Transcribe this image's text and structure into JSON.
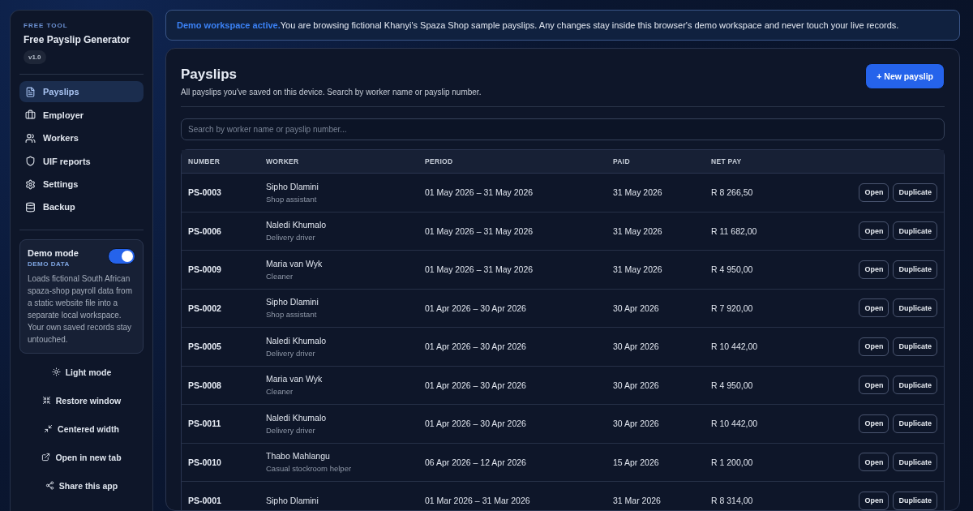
{
  "sidebar": {
    "eyebrow": "FREE TOOL",
    "title": "Free Payslip Generator",
    "version": "v1.0",
    "nav": [
      {
        "label": "Payslips",
        "selected": true
      },
      {
        "label": "Employer",
        "selected": false
      },
      {
        "label": "Workers",
        "selected": false
      },
      {
        "label": "UIF reports",
        "selected": false
      },
      {
        "label": "Settings",
        "selected": false
      },
      {
        "label": "Backup",
        "selected": false
      }
    ],
    "demo": {
      "title": "Demo mode",
      "on": true,
      "tag": "DEMO DATA",
      "text": "Loads fictional South African spaza-shop payroll data from a static website file into a separate local workspace. Your own saved records stay untouched."
    },
    "actions": [
      {
        "label": "Light mode"
      },
      {
        "label": "Restore window"
      },
      {
        "label": "Centered width"
      },
      {
        "label": "Open in new tab"
      },
      {
        "label": "Share this app"
      }
    ]
  },
  "banner": {
    "lead": "Demo workspace active.",
    "text": "You are browsing fictional Khanyi's Spaza Shop sample payslips. Any changes stay inside this browser's demo workspace and never touch your live records."
  },
  "page": {
    "title": "Payslips",
    "subtitle": "All payslips you've saved on this device. Search by worker name or payslip number.",
    "new_button": "+ New payslip",
    "search": {
      "placeholder": "Search by worker name or payslip number..."
    }
  },
  "table": {
    "columns": [
      "NUMBER",
      "WORKER",
      "PERIOD",
      "PAID",
      "NET PAY"
    ],
    "rows": [
      {
        "number": "PS-0003",
        "worker": "Sipho Dlamini",
        "role": "Shop assistant",
        "period": "01 May 2026 – 31 May 2026",
        "paid": "31 May 2026",
        "net": "R 8 266,50",
        "actions": [
          "Open",
          "Duplicate"
        ]
      },
      {
        "number": "PS-0006",
        "worker": "Naledi Khumalo",
        "role": "Delivery driver",
        "period": "01 May 2026 – 31 May 2026",
        "paid": "31 May 2026",
        "net": "R 11 682,00",
        "actions": [
          "Open",
          "Duplicate"
        ]
      },
      {
        "number": "PS-0009",
        "worker": "Maria van Wyk",
        "role": "Cleaner",
        "period": "01 May 2026 – 31 May 2026",
        "paid": "31 May 2026",
        "net": "R 4 950,00",
        "actions": [
          "Open",
          "Duplicate"
        ]
      },
      {
        "number": "PS-0002",
        "worker": "Sipho Dlamini",
        "role": "Shop assistant",
        "period": "01 Apr 2026 – 30 Apr 2026",
        "paid": "30 Apr 2026",
        "net": "R 7 920,00",
        "actions": [
          "Open",
          "Duplicate"
        ]
      },
      {
        "number": "PS-0005",
        "worker": "Naledi Khumalo",
        "role": "Delivery driver",
        "period": "01 Apr 2026 – 30 Apr 2026",
        "paid": "30 Apr 2026",
        "net": "R 10 442,00",
        "actions": [
          "Open",
          "Duplicate"
        ]
      },
      {
        "number": "PS-0008",
        "worker": "Maria van Wyk",
        "role": "Cleaner",
        "period": "01 Apr 2026 – 30 Apr 2026",
        "paid": "30 Apr 2026",
        "net": "R 4 950,00",
        "actions": [
          "Open",
          "Duplicate"
        ]
      },
      {
        "number": "PS-0011",
        "worker": "Naledi Khumalo",
        "role": "Delivery driver",
        "period": "01 Apr 2026 – 30 Apr 2026",
        "paid": "30 Apr 2026",
        "net": "R 10 442,00",
        "actions": [
          "Open",
          "Duplicate"
        ]
      },
      {
        "number": "PS-0010",
        "worker": "Thabo Mahlangu",
        "role": "Casual stockroom helper",
        "period": "06 Apr 2026 – 12 Apr 2026",
        "paid": "15 Apr 2026",
        "net": "R 1 200,00",
        "actions": [
          "Open",
          "Duplicate"
        ]
      },
      {
        "number": "PS-0001",
        "worker": "Sipho Dlamini",
        "period": "01 Mar 2026 – 31 Mar 2026",
        "paid": "31 Mar 2026",
        "net": "R 8 314,00",
        "actions": [
          "Open",
          "Duplicate"
        ]
      }
    ]
  }
}
